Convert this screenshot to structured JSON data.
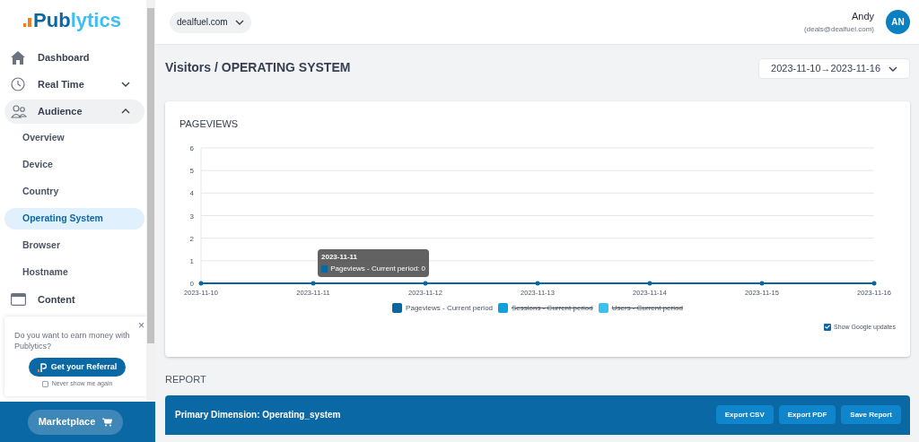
{
  "logo": {
    "parts": [
      "Pub",
      "lytics"
    ]
  },
  "sidebar": {
    "items": [
      {
        "label": "Dashboard",
        "selected": false
      },
      {
        "label": "Real Time",
        "selected": false,
        "expanded": false
      },
      {
        "label": "Audience",
        "selected": true,
        "expanded": true,
        "children": [
          {
            "label": "Overview",
            "selected": false
          },
          {
            "label": "Device",
            "selected": false
          },
          {
            "label": "Country",
            "selected": false
          },
          {
            "label": "Operating System",
            "selected": true
          },
          {
            "label": "Browser",
            "selected": false
          },
          {
            "label": "Hostname",
            "selected": false
          }
        ]
      },
      {
        "label": "Content",
        "selected": false
      }
    ]
  },
  "referral": {
    "text": "Do you want to earn money with Publytics?",
    "button": "Get your Referral",
    "checkbox": {
      "label": "Never show me again",
      "checked": false
    },
    "close": "×"
  },
  "marketplace": "Marketplace",
  "header": {
    "site": "dealfuel.com",
    "user": {
      "name": "Andy",
      "email": "(deals@dealfuel.com)",
      "initials": "AN"
    }
  },
  "page_title": "Visitors / OPERATING SYSTEM",
  "date_range": "2023-11-10→2023-11-16",
  "chart_card": {
    "title": "PAGEVIEWS",
    "chart_data": {
      "type": "line",
      "categories": [
        "2023-11-10",
        "2023-11-11",
        "2023-11-12",
        "2023-11-13",
        "2023-11-14",
        "2023-11-15",
        "2023-11-16"
      ],
      "ylim": [
        0,
        6
      ],
      "yticks": [
        0,
        1,
        2,
        3,
        4,
        5,
        6
      ],
      "grid": true,
      "series": [
        {
          "name": "Pageviews - Current period",
          "color": "#08679f",
          "values": [
            0,
            0,
            0,
            0,
            0,
            0,
            0
          ]
        }
      ]
    },
    "legend": [
      {
        "kind": "series",
        "hidden": false
      },
      {
        "label": "Sessions - Current period",
        "color": "#0fa0e0",
        "hidden": true
      },
      {
        "label": "Users - Current period",
        "color": "#3cc0f0",
        "hidden": true
      }
    ],
    "tooltip": {
      "title": "2023-11-11",
      "text": "Pageviews - Current period: 0"
    },
    "google_updates": {
      "label": "Show Google updates",
      "checked": true
    }
  },
  "report": {
    "title": "REPORT",
    "dimension": "Primary Dimension: Operating_system",
    "buttons": [
      "Export CSV",
      "Export PDF",
      "Save Report"
    ]
  }
}
